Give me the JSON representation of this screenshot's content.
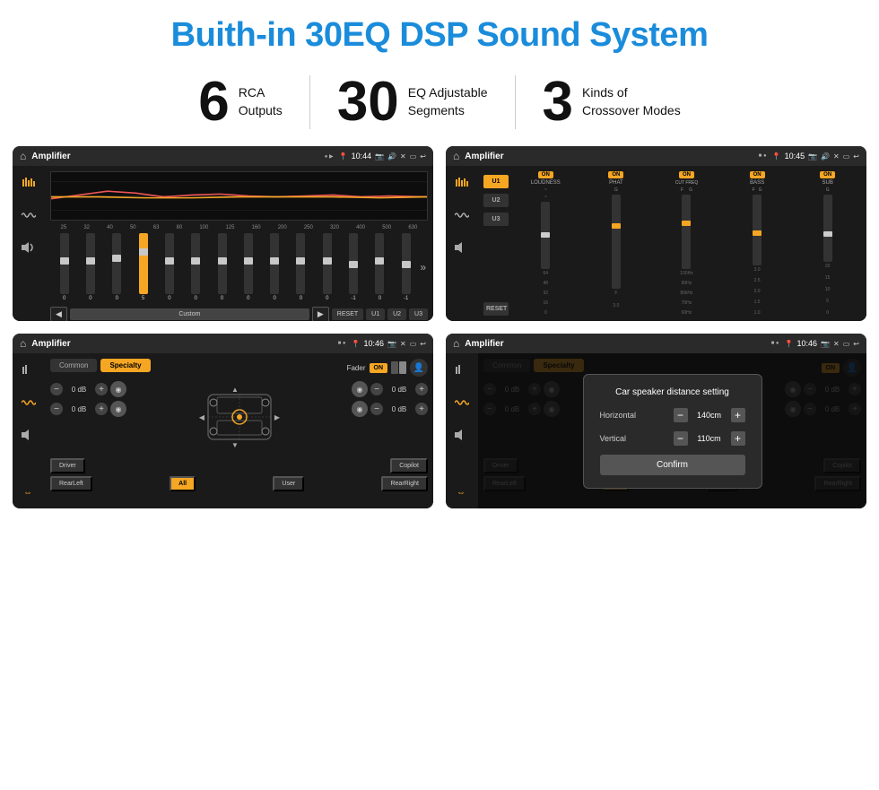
{
  "header": {
    "title": "Buith-in 30EQ DSP Sound System"
  },
  "features": [
    {
      "number": "6",
      "text_line1": "RCA",
      "text_line2": "Outputs"
    },
    {
      "number": "30",
      "text_line1": "EQ Adjustable",
      "text_line2": "Segments"
    },
    {
      "number": "3",
      "text_line1": "Kinds of",
      "text_line2": "Crossover Modes"
    }
  ],
  "screens": [
    {
      "id": "screen1",
      "status_title": "Amplifier",
      "status_time": "10:44",
      "type": "eq"
    },
    {
      "id": "screen2",
      "status_title": "Amplifier",
      "status_time": "10:45",
      "type": "amp_bands"
    },
    {
      "id": "screen3",
      "status_title": "Amplifier",
      "status_time": "10:46",
      "type": "fader"
    },
    {
      "id": "screen4",
      "status_title": "Amplifier",
      "status_time": "10:46",
      "type": "fader_dialog"
    }
  ],
  "eq": {
    "freq_labels": [
      "25",
      "32",
      "40",
      "50",
      "63",
      "80",
      "100",
      "125",
      "160",
      "200",
      "250",
      "320",
      "400",
      "500",
      "630"
    ],
    "values": [
      "0",
      "0",
      "0",
      "5",
      "0",
      "0",
      "0",
      "0",
      "0",
      "0",
      "0",
      "-1",
      "0",
      "-1"
    ],
    "mode": "Custom",
    "buttons": [
      "RESET",
      "U1",
      "U2",
      "U3"
    ]
  },
  "amp_bands": {
    "presets": [
      "U1",
      "U2",
      "U3"
    ],
    "bands": [
      "LOUDNESS",
      "PHAT",
      "CUT FREQ",
      "BASS",
      "SUB"
    ],
    "labels": [
      "64",
      "32",
      "16",
      "0"
    ]
  },
  "fader": {
    "tabs": [
      "Common",
      "Specialty"
    ],
    "active_tab": "Specialty",
    "fader_label": "Fader",
    "on_label": "ON",
    "positions": [
      "Driver",
      "Copilot",
      "RearLeft",
      "All",
      "User",
      "RearRight"
    ],
    "db_values": [
      "0 dB",
      "0 dB",
      "0 dB",
      "0 dB"
    ]
  },
  "dialog": {
    "title": "Car speaker distance setting",
    "horizontal_label": "Horizontal",
    "horizontal_value": "140cm",
    "vertical_label": "Vertical",
    "vertical_value": "110cm",
    "confirm_label": "Confirm"
  }
}
